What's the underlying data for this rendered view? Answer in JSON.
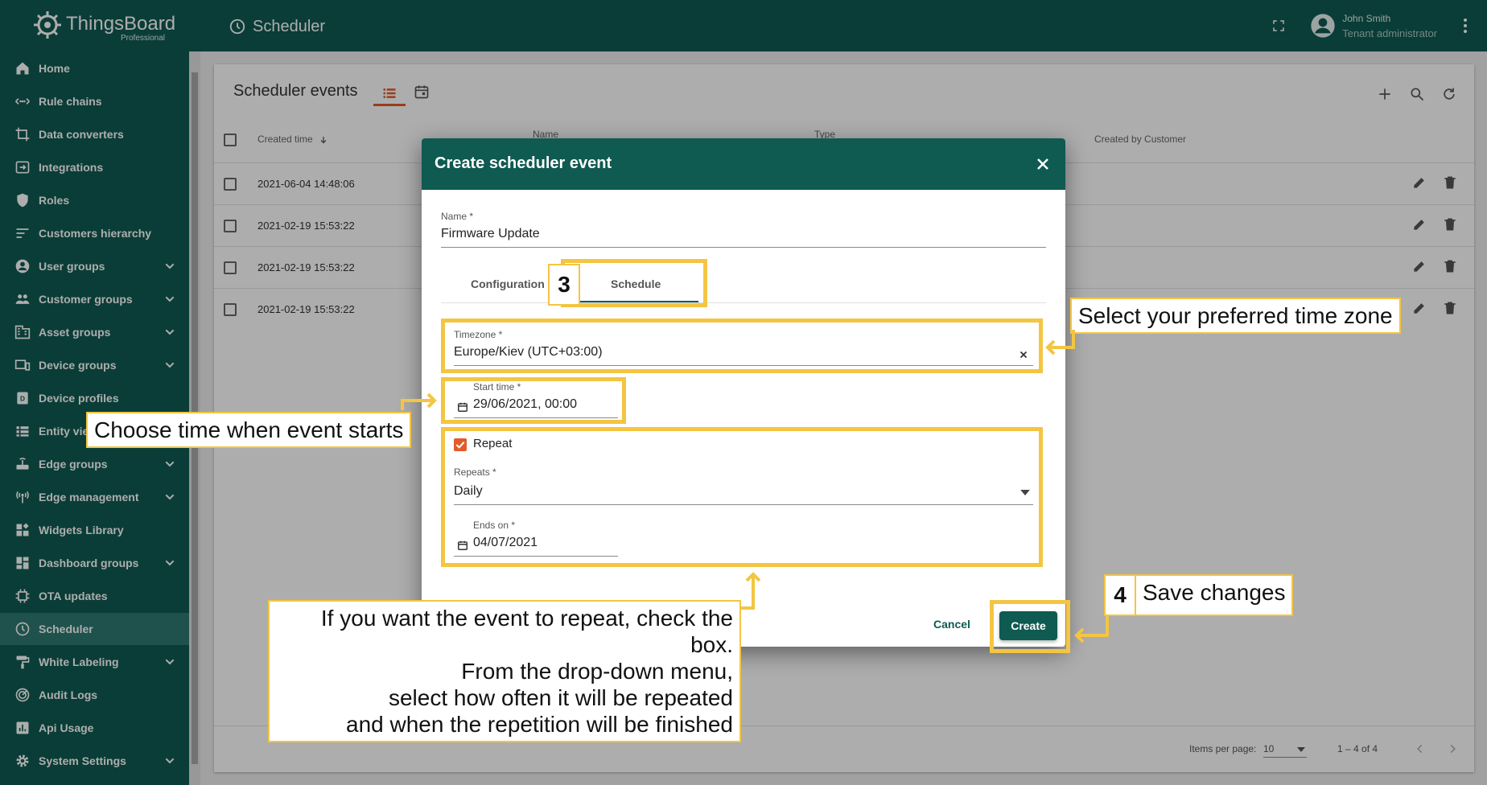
{
  "app": {
    "brand_name": "ThingsBoard",
    "brand_sub": "Professional",
    "page_title": "Scheduler",
    "user_name": "John Smith",
    "user_role": "Tenant administrator"
  },
  "sidebar": {
    "items": [
      {
        "label": "Home",
        "icon": "home-icon",
        "expandable": false
      },
      {
        "label": "Rule chains",
        "icon": "rule-chain-icon",
        "expandable": false
      },
      {
        "label": "Data converters",
        "icon": "converter-icon",
        "expandable": false
      },
      {
        "label": "Integrations",
        "icon": "integration-icon",
        "expandable": false
      },
      {
        "label": "Roles",
        "icon": "shield-icon",
        "expandable": false
      },
      {
        "label": "Customers hierarchy",
        "icon": "hierarchy-icon",
        "expandable": false
      },
      {
        "label": "User groups",
        "icon": "account-icon",
        "expandable": true
      },
      {
        "label": "Customer groups",
        "icon": "group-icon",
        "expandable": true
      },
      {
        "label": "Asset groups",
        "icon": "domain-icon",
        "expandable": true
      },
      {
        "label": "Device groups",
        "icon": "devices-icon",
        "expandable": true
      },
      {
        "label": "Device profiles",
        "icon": "device-profile-icon",
        "expandable": false
      },
      {
        "label": "Entity views",
        "icon": "view-icon",
        "expandable": false
      },
      {
        "label": "Edge groups",
        "icon": "router-icon",
        "expandable": true
      },
      {
        "label": "Edge management",
        "icon": "antenna-icon",
        "expandable": true
      },
      {
        "label": "Widgets Library",
        "icon": "widgets-icon",
        "expandable": false
      },
      {
        "label": "Dashboard groups",
        "icon": "dashboard-icon",
        "expandable": true
      },
      {
        "label": "OTA updates",
        "icon": "memory-icon",
        "expandable": false
      },
      {
        "label": "Scheduler",
        "icon": "clock-icon",
        "expandable": false,
        "active": true
      },
      {
        "label": "White Labeling",
        "icon": "paint-roller-icon",
        "expandable": true
      },
      {
        "label": "Audit Logs",
        "icon": "track-changes-icon",
        "expandable": false
      },
      {
        "label": "Api Usage",
        "icon": "insert-chart-icon",
        "expandable": false
      },
      {
        "label": "System Settings",
        "icon": "gear-icon",
        "expandable": true
      }
    ]
  },
  "table": {
    "title": "Scheduler events",
    "headers": {
      "created_time": "Created time",
      "name": "Name",
      "type": "Type",
      "created_by_customer": "Created by Customer"
    },
    "rows": [
      {
        "created_time": "2021-06-04 14:48:06"
      },
      {
        "created_time": "2021-02-19 15:53:22"
      },
      {
        "created_time": "2021-02-19 15:53:22"
      },
      {
        "created_time": "2021-02-19 15:53:22"
      }
    ],
    "pager": {
      "items_per_page_label": "Items per page:",
      "items_per_page": "10",
      "range": "1 – 4 of 4"
    }
  },
  "dialog": {
    "title": "Create scheduler event",
    "name_label": "Name *",
    "name_value": "Firmware Update",
    "tabs": [
      "Configuration",
      "Schedule"
    ],
    "timezone_label": "Timezone *",
    "timezone_value": "Europe/Kiev (UTC+03:00)",
    "start_label": "Start time *",
    "start_value": "29/06/2021, 00:00",
    "repeat_label": "Repeat",
    "repeats_label": "Repeats *",
    "repeats_value": "Daily",
    "ends_label": "Ends on *",
    "ends_value": "04/07/2021",
    "cancel": "Cancel",
    "create": "Create"
  },
  "annotations": {
    "step3": "3",
    "step4": "4",
    "timezone_hint": "Select your preferred time zone",
    "start_hint": "Choose time when event starts",
    "save_hint": "Save changes",
    "repeat_hint_lines": [
      "If you want the event to repeat, check the box.",
      "From the drop-down menu,",
      "select how often it will be repeated",
      "and when the repetition will be finished"
    ],
    "highlight_color": "#f4c542"
  }
}
